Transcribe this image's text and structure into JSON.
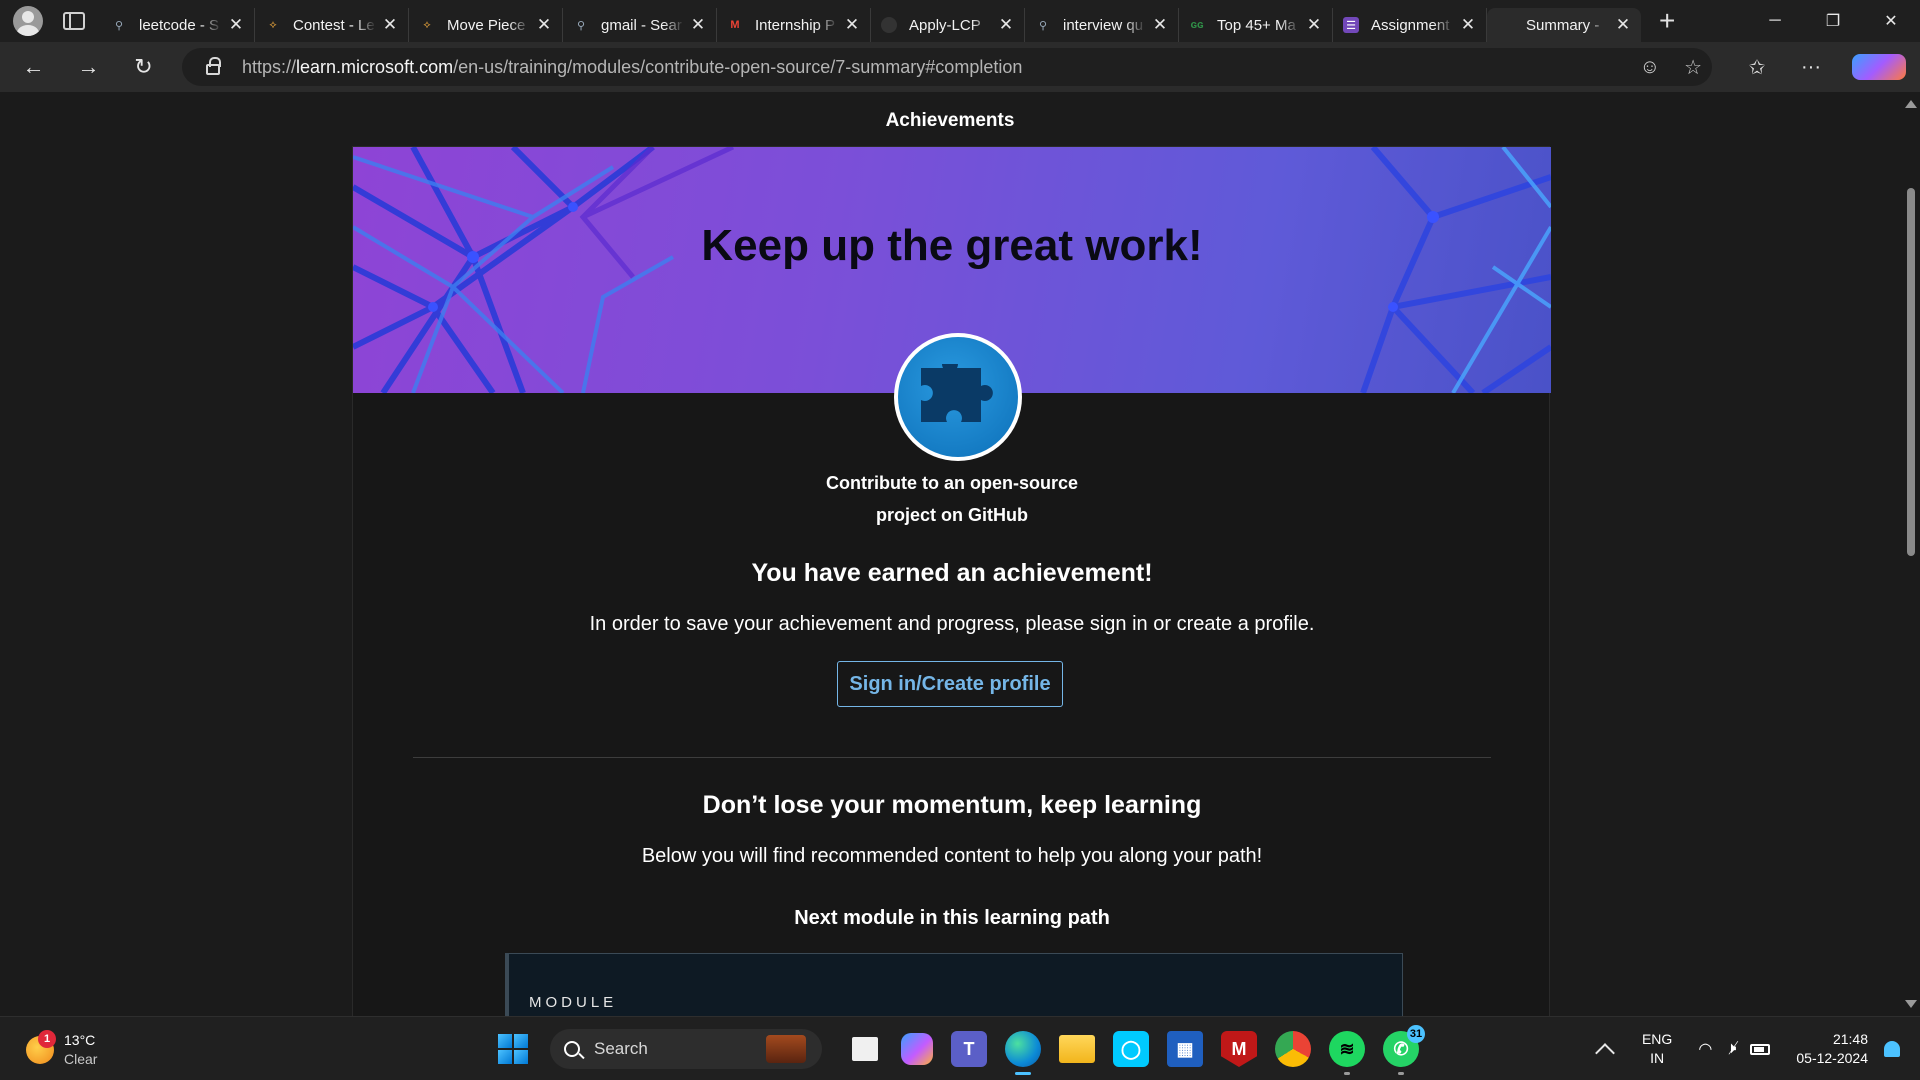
{
  "browser": {
    "tabs": [
      {
        "title": "leetcode - S",
        "icon": "search-icon",
        "active": false
      },
      {
        "title": "Contest - Le",
        "icon": "leetcode-icon",
        "active": false
      },
      {
        "title": "Move Piece",
        "icon": "leetcode-icon",
        "active": false
      },
      {
        "title": "gmail - Sear",
        "icon": "search-icon",
        "active": false
      },
      {
        "title": "Internship P",
        "icon": "gmail-icon",
        "active": false
      },
      {
        "title": "Apply-LCP",
        "icon": "github-icon",
        "active": false
      },
      {
        "title": "interview qu",
        "icon": "search-icon",
        "active": false
      },
      {
        "title": "Top 45+ Ma",
        "icon": "gfg-icon",
        "active": false
      },
      {
        "title": "Assignment",
        "icon": "forms-icon",
        "active": false
      },
      {
        "title": "Summary -",
        "icon": "microsoft-icon",
        "active": true
      }
    ],
    "url_prefix": "https://",
    "url_host": "learn.microsoft.com",
    "url_path": "/en-us/training/modules/contribute-open-source/7-summary#completion"
  },
  "page": {
    "heading": "Achievements",
    "hero_title": "Keep up the great work!",
    "module_name_line1": "Contribute to an open-source",
    "module_name_line2": "project on GitHub",
    "earned": "You have earned an achievement!",
    "save_message": "In order to save your achievement and progress, please sign in or create a profile.",
    "signin_label": "Sign in/Create profile",
    "momentum_heading": "Don’t lose your momentum, keep learning",
    "recommended_text": "Below you will find recommended content to help you along your path!",
    "next_module_heading": "Next module in this learning path",
    "module_card_label": "MODULE"
  },
  "taskbar": {
    "weather_temp": "13°C",
    "weather_cond": "Clear",
    "weather_badge": "1",
    "search_placeholder": "Search",
    "whatsapp_count": "31",
    "lang_line1": "ENG",
    "lang_line2": "IN",
    "time": "21:48",
    "date": "05-12-2024"
  },
  "colors": {
    "accent_link": "#75b6e7",
    "hero_start": "#8e44d6",
    "hero_end": "#4a52c8",
    "badge_blue": "#0c6fb8"
  }
}
